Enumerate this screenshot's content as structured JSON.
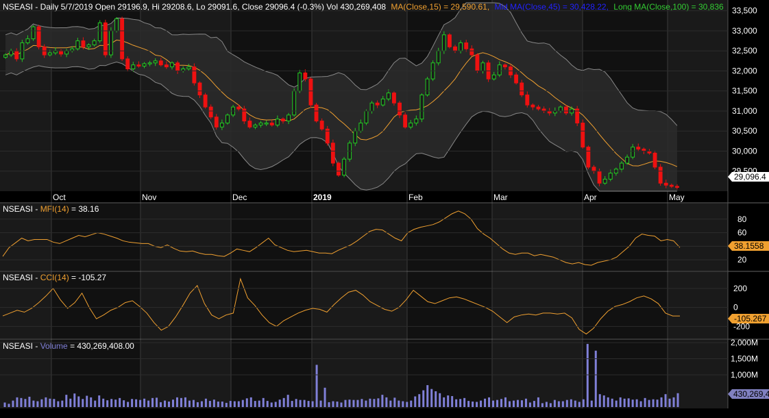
{
  "header": {
    "prefix": "NSEASI - Daily 5/7/2019 Open 29196.9, Hi 29208.6, Lo 29091.6, Close 29096.4 (-0.3%) Vol 430,269,408",
    "ma_label": "MA(Close,15) = 29,590.61,",
    "mid_label": "Mid MA(Close,45) = 30,428.22,",
    "long_label": "Long MA(Close,100) = 30,836"
  },
  "panels": {
    "mfi_title_prefix": "NSEASI - ",
    "mfi_title_name": "MFI(14)",
    "mfi_title_value": " = 38.16",
    "mfi_badge": "38.1558",
    "cci_title_prefix": "NSEASI - ",
    "cci_title_name": "CCI(14)",
    "cci_title_value": " = -105.27",
    "cci_badge": "-105.267",
    "vol_title_prefix": "NSEASI - ",
    "vol_title_name": "Volume",
    "vol_title_value": " = 430,269,408.00",
    "vol_badge": "430,269,4",
    "price_badge": "29,096.4"
  },
  "colors": {
    "background": "#000000",
    "panel_bg": "#1a1a1a",
    "band_fill": "#2a2a2a",
    "up_candle": "#22cc22",
    "down_candle": "#ee1111",
    "ma_line": "#f0a030",
    "band_line": "#888888",
    "indicator_line": "#f0a030",
    "volume_bar": "#8080d8",
    "axis_text": "#ffffff",
    "ma_text": "#f0a030",
    "mid_text": "#2222ff",
    "long_text": "#33cc33",
    "volume_text": "#8080d8",
    "badge_orange": "#f0a030",
    "badge_volume": "#8080c0"
  },
  "chart_data": [
    {
      "type": "candlestick",
      "title": "NSEASI - Daily",
      "x_labels": [
        "Oct",
        "Nov",
        "Dec",
        "2019",
        "Feb",
        "Mar",
        "Apr",
        "May"
      ],
      "y_ticks": [
        "33,500",
        "33,000",
        "32,500",
        "32,000",
        "31,500",
        "31,000",
        "30,500",
        "30,000",
        "29,500"
      ],
      "ylim": [
        29000,
        33700
      ],
      "series_close": [
        32400,
        32500,
        32300,
        32700,
        32800,
        33100,
        32600,
        32400,
        32450,
        32500,
        32420,
        32500,
        32550,
        32750,
        32600,
        32650,
        32750,
        33200,
        32400,
        33000,
        33300,
        32300,
        32050,
        32150,
        32120,
        32180,
        32200,
        32250,
        32150,
        32100,
        32200,
        32000,
        32050,
        32100,
        31700,
        31400,
        31100,
        30850,
        30600,
        30700,
        30900,
        31100,
        31050,
        30750,
        30600,
        30650,
        30700,
        30700,
        30650,
        30800,
        30750,
        30900,
        31500,
        31950,
        31800,
        31150,
        30750,
        30550,
        30200,
        29700,
        29400,
        29800,
        30200,
        30500,
        30700,
        31000,
        31200,
        31150,
        31300,
        31450,
        31200,
        30900,
        30600,
        30700,
        30800,
        31400,
        31800,
        32200,
        32500,
        32900,
        32600,
        32500,
        32700,
        32550,
        32400,
        32000,
        32200,
        31800,
        31900,
        32150,
        32100,
        31900,
        31700,
        31400,
        31150,
        31100,
        31050,
        31000,
        30950,
        31000,
        31100,
        30950,
        31050,
        30700,
        30100,
        29600,
        29500,
        29200,
        29300,
        29450,
        29550,
        29700,
        29850,
        30100,
        30050,
        30000,
        29950,
        29600,
        29200,
        29150,
        29120,
        29096.4
      ],
      "ma15_last": 29590.61,
      "mid_ma45_last": 30428.22,
      "long_ma100_last": 30836,
      "last_close": 29096.4
    },
    {
      "type": "line",
      "title": "MFI(14)",
      "y_ticks": [
        "80",
        "60",
        "40",
        "20"
      ],
      "ylim": [
        5,
        100
      ],
      "values": [
        25,
        38,
        45,
        52,
        48,
        50,
        50,
        50,
        46,
        44,
        48,
        52,
        56,
        54,
        57,
        60,
        58,
        55,
        52,
        48,
        46,
        45,
        44,
        44,
        40,
        38,
        42,
        37,
        33,
        32,
        33,
        30,
        28,
        28,
        26,
        25,
        30,
        36,
        34,
        32,
        38,
        45,
        52,
        42,
        38,
        34,
        32,
        33,
        34,
        32,
        30,
        30,
        29,
        34,
        38,
        42,
        48,
        55,
        62,
        65,
        64,
        58,
        52,
        48,
        60,
        65,
        68,
        70,
        72,
        76,
        82,
        88,
        92,
        88,
        80,
        66,
        58,
        52,
        44,
        36,
        30,
        28,
        30,
        30,
        26,
        28,
        26,
        24,
        20,
        16,
        14,
        16,
        13,
        12,
        16,
        18,
        20,
        24,
        32,
        40,
        52,
        58,
        56,
        55,
        48,
        50,
        48,
        38.16
      ]
    },
    {
      "type": "line",
      "title": "CCI(14)",
      "y_ticks": [
        "200",
        "0",
        "-200"
      ],
      "ylim": [
        -320,
        350
      ],
      "values": [
        -90,
        -60,
        -30,
        -50,
        -10,
        50,
        120,
        200,
        80,
        -10,
        50,
        150,
        0,
        -120,
        -80,
        -30,
        0,
        50,
        70,
        10,
        -60,
        -160,
        -240,
        -200,
        -100,
        20,
        150,
        230,
        40,
        -80,
        -120,
        -80,
        -60,
        300,
        100,
        20,
        -80,
        -160,
        -200,
        -140,
        -100,
        -60,
        -30,
        -10,
        -20,
        -50,
        30,
        100,
        160,
        180,
        130,
        60,
        20,
        -20,
        -40,
        0,
        80,
        180,
        120,
        60,
        40,
        70,
        100,
        110,
        90,
        60,
        30,
        0,
        -40,
        -100,
        -160,
        -100,
        -80,
        -70,
        -80,
        -60,
        -60,
        -70,
        -60,
        -110,
        -230,
        -280,
        -220,
        -120,
        -40,
        10,
        30,
        60,
        100,
        120,
        90,
        40,
        -60,
        -90,
        -90
      ]
    },
    {
      "type": "bar",
      "title": "Volume",
      "y_ticks": [
        "2,000M",
        "1,500M",
        "1,000M"
      ],
      "ylim": [
        0,
        2000000000
      ],
      "values": [
        140,
        100,
        200,
        300,
        280,
        250,
        320,
        200,
        180,
        240,
        300,
        260,
        250,
        180,
        200,
        380,
        260,
        420,
        330,
        250,
        350,
        300,
        200,
        360,
        260,
        210,
        250,
        230,
        280,
        210,
        160,
        250,
        240,
        220,
        260,
        200,
        280,
        290,
        150,
        200,
        170,
        230,
        300,
        280,
        300,
        200,
        220,
        150,
        180,
        260,
        190,
        230,
        170,
        170,
        130,
        190,
        180,
        180,
        220,
        270,
        300,
        190,
        200,
        280,
        190,
        140,
        160,
        230,
        280,
        380,
        190,
        250,
        220,
        220,
        190,
        180,
        1310,
        200,
        600,
        150,
        180,
        170,
        140,
        220,
        230,
        220,
        220,
        250,
        200,
        260,
        250,
        270,
        380,
        300,
        200,
        290,
        200,
        180,
        160,
        200,
        330,
        400,
        520,
        680,
        560,
        490,
        430,
        300,
        360,
        340,
        240,
        250,
        280,
        190,
        170,
        160,
        200,
        260,
        300,
        200,
        220,
        250,
        300,
        180,
        200,
        220,
        210,
        260,
        140,
        190,
        300,
        120,
        160,
        120,
        220,
        180,
        180,
        220,
        240,
        200,
        160,
        240,
        1960,
        200,
        1750,
        400,
        360,
        300,
        260,
        200,
        300,
        260,
        270,
        230,
        240,
        180,
        280,
        220,
        240,
        230,
        300,
        400,
        260,
        300,
        430
      ],
      "last_value": 430269408
    }
  ]
}
